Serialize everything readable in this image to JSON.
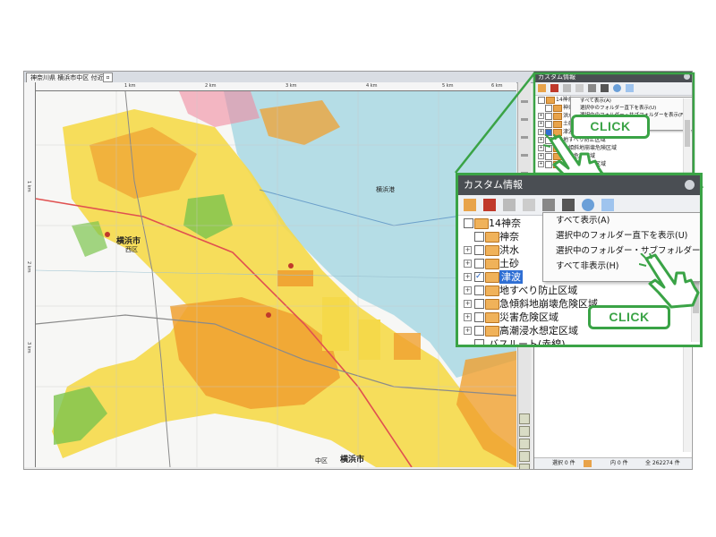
{
  "map_window": {
    "tab_title": "神奈川県 横浜市中区 付近",
    "scale_labels": [
      "1 km",
      "2 km",
      "3 km",
      "4 km",
      "5 km",
      "6 km"
    ],
    "vertical_labels": [
      "1 km",
      "2 km",
      "3 km"
    ],
    "place_labels": {
      "yokohama_nishi": "横浜市",
      "nishi_ku": "西区",
      "yokohama_port": "横浜港",
      "yokohama_naka": "横浜市",
      "naka_ku": "中区"
    }
  },
  "panel_small": {
    "title": "カスタム情報",
    "tree": [
      {
        "label": "14神奈",
        "level": 0
      },
      {
        "label": "神奈",
        "level": 1
      },
      {
        "label": "洪水",
        "level": 1
      },
      {
        "label": "土砂",
        "level": 1
      },
      {
        "label": "津波",
        "level": 1
      },
      {
        "label": "地すべり防止区域",
        "level": 1
      },
      {
        "label": "急傾斜地崩壊危険区域",
        "level": 1
      },
      {
        "label": "災害危険区域",
        "level": 1
      },
      {
        "label": "高潮浸水想定区域",
        "level": 1
      }
    ],
    "menu": [
      "すべて表示(A)",
      "選択中のフォルダー直下を表示(U)",
      "選択中のフォルダー・サブフォルダーを表示(F)"
    ],
    "status": {
      "selected": "選択 0 件",
      "inner": "内 0 件",
      "total": "全 262274 件"
    }
  },
  "callouts": {
    "click_top": "CLICK",
    "click_bottom": "CLICK"
  },
  "panel_zoom": {
    "title": "カスタム情報",
    "tree": [
      {
        "label": "14神奈",
        "checked": false,
        "expander": "",
        "selected": false
      },
      {
        "label": "神奈",
        "checked": false,
        "expander": "",
        "selected": false
      },
      {
        "label": "洪水",
        "checked": false,
        "expander": "+",
        "selected": false
      },
      {
        "label": "土砂",
        "checked": false,
        "expander": "+",
        "selected": false
      },
      {
        "label": "津波",
        "checked": true,
        "expander": "+",
        "selected": true
      },
      {
        "label": "地すべり防止区域",
        "checked": false,
        "expander": "+",
        "selected": false
      },
      {
        "label": "急傾斜地崩壊危険区域",
        "checked": false,
        "expander": "+",
        "selected": false
      },
      {
        "label": "災害危険区域",
        "checked": false,
        "expander": "+",
        "selected": false
      },
      {
        "label": "高潮浸水想定区域",
        "checked": false,
        "expander": "+",
        "selected": false
      },
      {
        "label": "バスルート(赤線)",
        "checked": false,
        "expander": "",
        "selected": false
      }
    ],
    "menu": [
      "すべて表示(A)",
      "選択中のフォルダー直下を表示(U)",
      "選択中のフォルダー・サブフォルダーを表示(F)",
      "すべて非表示(H)"
    ]
  },
  "colors": {
    "accent_green": "#3aa346",
    "panel_header": "#4a4e53",
    "hazard_yellow": "#f5d94a",
    "hazard_orange": "#f0a030",
    "sea": "#b5dde6"
  }
}
